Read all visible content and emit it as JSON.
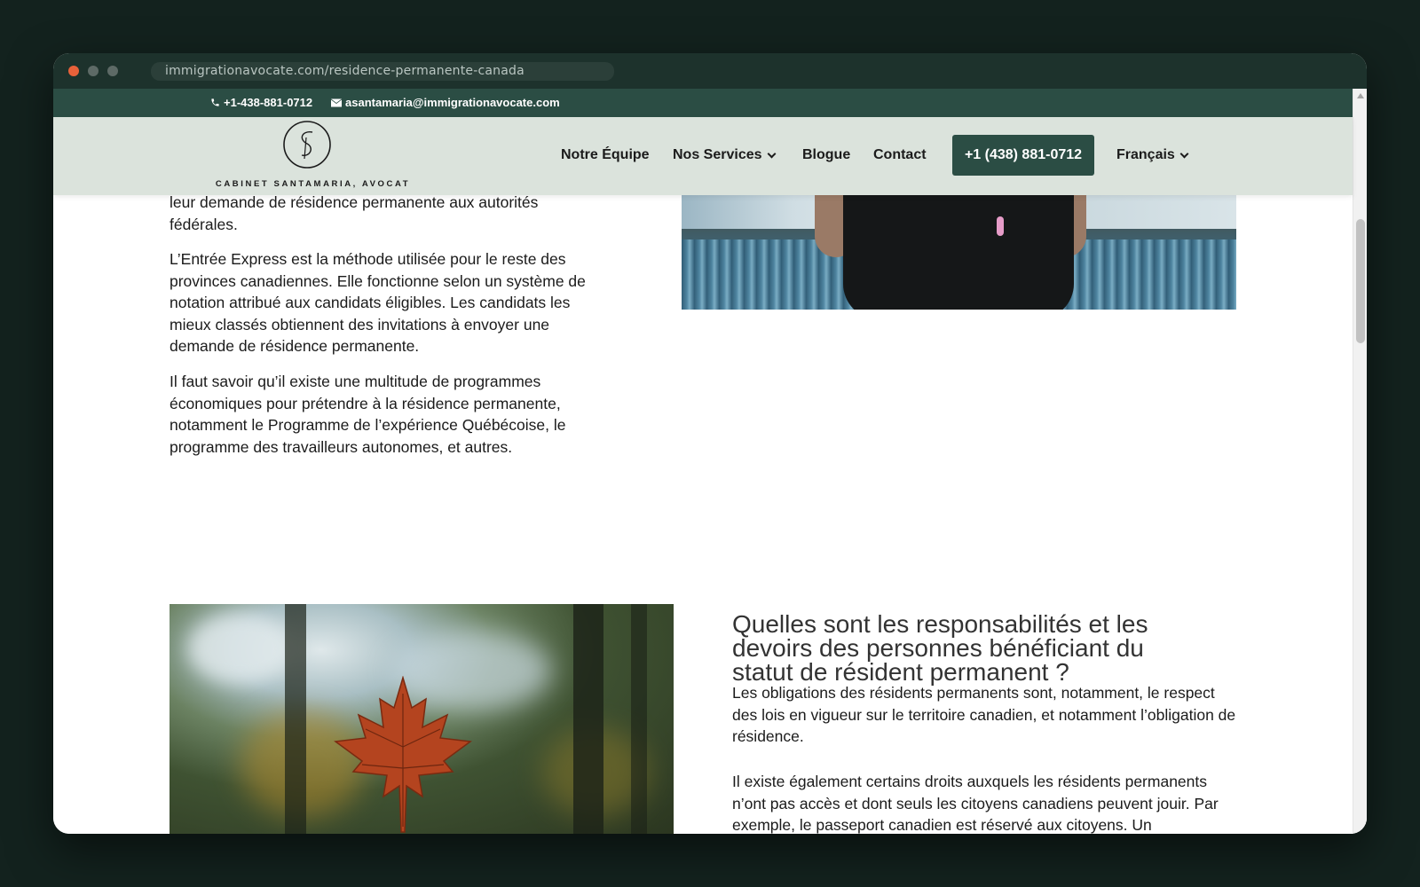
{
  "browser": {
    "url": "immigrationavocate.com/residence-permanente-canada"
  },
  "topbar": {
    "phone": "+1-438-881-0712",
    "email": "asantamaria@immigrationavocate.com"
  },
  "header": {
    "logo_text": "CABINET SANTAMARIA, AVOCAT",
    "nav": {
      "team": "Notre Équipe",
      "services": "Nos Services",
      "blog": "Blogue",
      "contact": "Contact",
      "cta": "+1 (438) 881-0712",
      "language": "Français"
    }
  },
  "section1": {
    "p1": "leur demande de résidence permanente aux autorités fédérales.",
    "p2": "L’Entrée Express est la méthode utilisée pour le reste des provinces canadiennes. Elle fonctionne selon un système de notation attribué aux candidats éligibles. Les candidats les mieux classés obtiennent des invitations à envoyer une demande de résidence permanente.",
    "p3": "Il faut savoir qu’il existe une multitude de programmes économiques pour prétendre à la résidence permanente, notamment le Programme de l’expérience Québécoise, le programme des travailleurs autonomes, et autres."
  },
  "section2": {
    "heading": "Quelles sont les responsabilités et les devoirs des personnes bénéficiant du statut de résident permanent ?",
    "p1": "Les obligations des résidents permanents sont, notamment, le respect des lois en vigueur sur le territoire canadien, et notamment l’obligation de résidence.",
    "p2": "Il existe également certains droits auxquels les résidents permanents n’ont pas accès et dont seuls les citoyens canadiens peuvent jouir. Par exemple, le passeport canadien est réservé aux citoyens. Un"
  },
  "colors": {
    "page_bg": "#13221e",
    "chrome": "#1d322c",
    "topbar": "#2b4d44",
    "header": "#dbe3dc",
    "cta": "#2b4d44"
  }
}
